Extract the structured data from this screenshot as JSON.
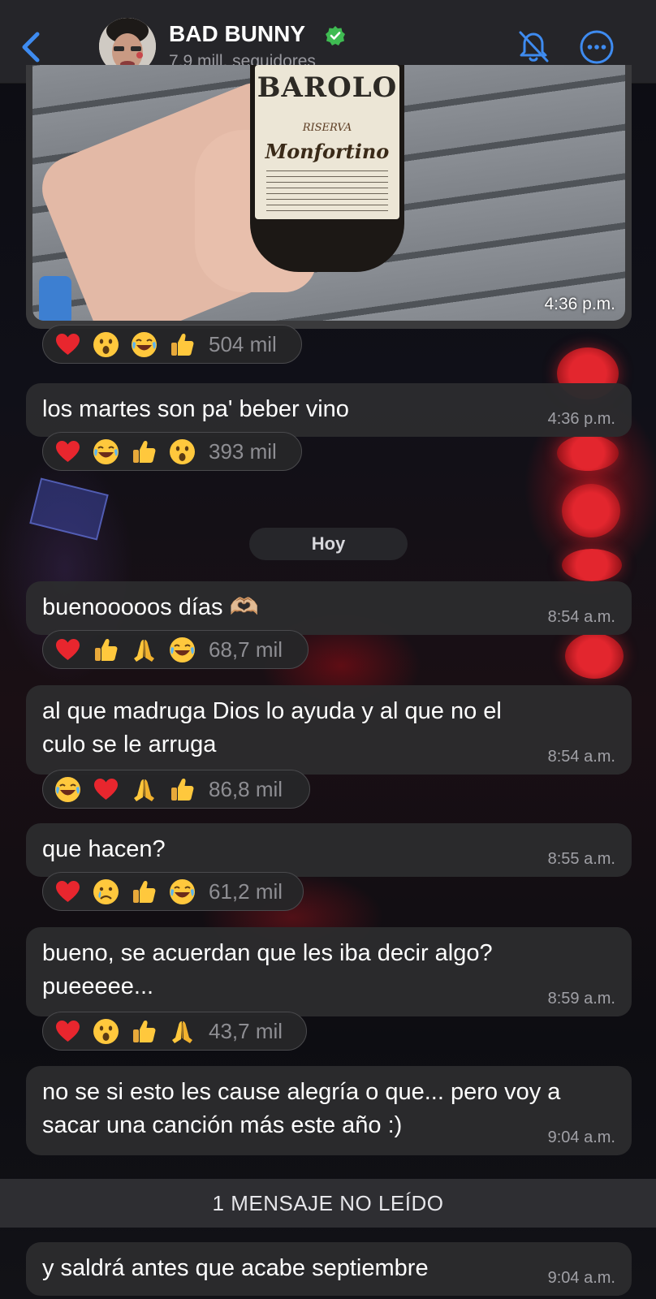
{
  "header": {
    "title": "BAD BUNNY",
    "subtitle": "7,9 mill. seguidores"
  },
  "photo_label": {
    "brand": "BAROLO",
    "line2": "RISERVA",
    "line3": "Monfortino"
  },
  "date_separator": "Hoy",
  "unread_banner": "1 MENSAJE NO LEÍDO",
  "messages": [
    {
      "type": "photo",
      "time": "4:36 p.m.",
      "reactions": {
        "emojis": [
          "heart",
          "surprised",
          "laughing",
          "thumbs-up"
        ],
        "count": "504 mil"
      }
    },
    {
      "text": "los martes son pa' beber vino",
      "time": "4:36 p.m.",
      "reactions": {
        "emojis": [
          "heart",
          "laughing",
          "thumbs-up",
          "surprised"
        ],
        "count": "393 mil"
      }
    },
    {
      "text": "buenooooos días 🫶🏼",
      "time": "8:54 a.m.",
      "reactions": {
        "emojis": [
          "heart",
          "thumbs-up",
          "folded-hands",
          "laughing"
        ],
        "count": "68,7 mil"
      }
    },
    {
      "text": "al que madruga Dios lo ayuda y al que no el culo se le arruga",
      "time": "8:54 a.m.",
      "reactions": {
        "emojis": [
          "laughing",
          "heart",
          "folded-hands",
          "thumbs-up"
        ],
        "count": "86,8 mil"
      }
    },
    {
      "text": "que hacen?",
      "time": "8:55 a.m.",
      "reactions": {
        "emojis": [
          "heart",
          "crying",
          "thumbs-up",
          "laughing"
        ],
        "count": "61,2 mil"
      }
    },
    {
      "text": "bueno, se acuerdan que les iba decir algo? pueeeee...",
      "time": "8:59 a.m.",
      "reactions": {
        "emojis": [
          "heart",
          "surprised",
          "thumbs-up",
          "folded-hands"
        ],
        "count": "43,7 mil"
      }
    },
    {
      "text": "no se si esto les cause alegría o que... pero voy a sacar una canción más este año :)",
      "time": "9:04 a.m."
    },
    {
      "text": "y saldrá antes que acabe septiembre",
      "time": "9:04 a.m."
    }
  ],
  "colors": {
    "accent": "#3e8bf0",
    "verified": "#3fbb52",
    "bubble": "#2c2c2e",
    "header_bg": "#262628"
  }
}
